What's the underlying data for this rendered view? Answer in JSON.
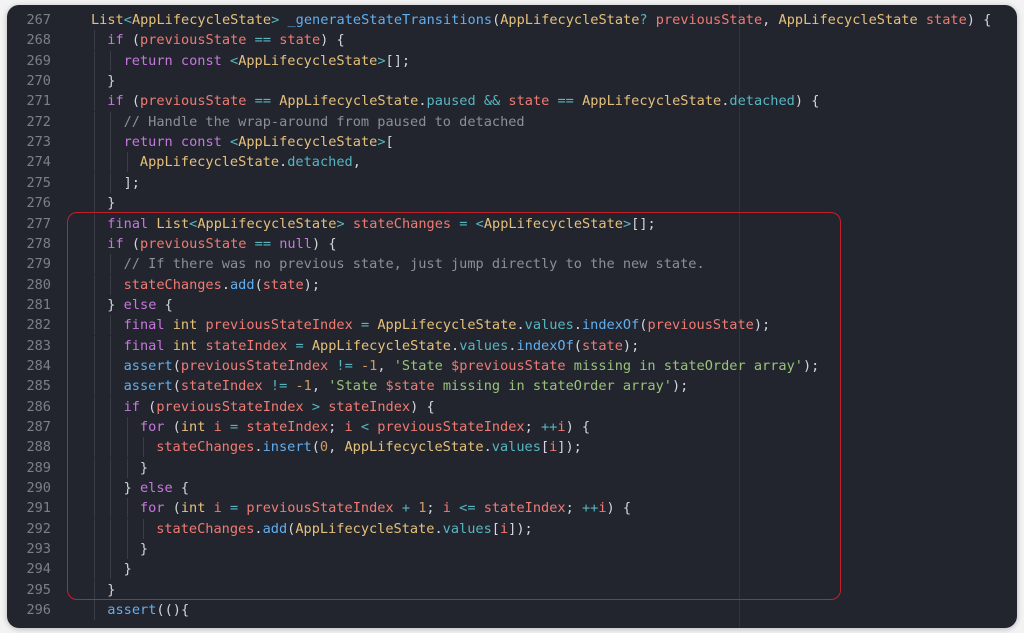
{
  "editor": {
    "lines": [
      {
        "n": "267",
        "indent": 0,
        "tokens": [
          [
            "ty",
            "List"
          ],
          [
            "op",
            "<"
          ],
          [
            "ty",
            "AppLifecycleState"
          ],
          [
            "op",
            "> "
          ],
          [
            "fn",
            "_generateStateTransitions"
          ],
          [
            "",
            "("
          ],
          [
            "ty",
            "AppLifecycleState"
          ],
          [
            "op",
            "? "
          ],
          [
            "pr",
            "previousState"
          ],
          [
            "",
            ", "
          ],
          [
            "ty",
            "AppLifecycleState"
          ],
          [
            "",
            " "
          ],
          [
            "pr",
            "state"
          ],
          [
            "",
            ") {"
          ]
        ]
      },
      {
        "n": "268",
        "indent": 1,
        "tokens": [
          [
            "kw",
            "if"
          ],
          [
            "",
            " ("
          ],
          [
            "pr",
            "previousState"
          ],
          [
            "op",
            " == "
          ],
          [
            "pr",
            "state"
          ],
          [
            "",
            ") {"
          ]
        ]
      },
      {
        "n": "269",
        "indent": 2,
        "tokens": [
          [
            "kw",
            "return"
          ],
          [
            "",
            " "
          ],
          [
            "kw",
            "const"
          ],
          [
            "",
            " "
          ],
          [
            "op",
            "<"
          ],
          [
            "ty",
            "AppLifecycleState"
          ],
          [
            "op",
            ">"
          ],
          [
            "",
            "[];"
          ]
        ]
      },
      {
        "n": "270",
        "indent": 1,
        "tokens": [
          [
            "",
            "}"
          ]
        ]
      },
      {
        "n": "271",
        "indent": 1,
        "tokens": [
          [
            "kw",
            "if"
          ],
          [
            "",
            " ("
          ],
          [
            "pr",
            "previousState"
          ],
          [
            "op",
            " == "
          ],
          [
            "ty",
            "AppLifecycleState"
          ],
          [
            "",
            "."
          ],
          [
            "op",
            "paused"
          ],
          [
            "op",
            " && "
          ],
          [
            "pr",
            "state"
          ],
          [
            "op",
            " == "
          ],
          [
            "ty",
            "AppLifecycleState"
          ],
          [
            "",
            "."
          ],
          [
            "op",
            "detached"
          ],
          [
            "",
            ") {"
          ]
        ]
      },
      {
        "n": "272",
        "indent": 2,
        "tokens": [
          [
            "cm",
            "// Handle the wrap-around from paused to detached"
          ]
        ]
      },
      {
        "n": "273",
        "indent": 2,
        "tokens": [
          [
            "kw",
            "return"
          ],
          [
            "",
            " "
          ],
          [
            "kw",
            "const"
          ],
          [
            "",
            " "
          ],
          [
            "op",
            "<"
          ],
          [
            "ty",
            "AppLifecycleState"
          ],
          [
            "op",
            ">"
          ],
          [
            "",
            "["
          ]
        ]
      },
      {
        "n": "274",
        "indent": 3,
        "tokens": [
          [
            "ty",
            "AppLifecycleState"
          ],
          [
            "",
            "."
          ],
          [
            "op",
            "detached"
          ],
          [
            "",
            ","
          ]
        ]
      },
      {
        "n": "275",
        "indent": 2,
        "tokens": [
          [
            "",
            "];"
          ]
        ]
      },
      {
        "n": "276",
        "indent": 1,
        "tokens": [
          [
            "",
            "}"
          ]
        ]
      },
      {
        "n": "277",
        "indent": 1,
        "tokens": [
          [
            "kw",
            "final"
          ],
          [
            "",
            " "
          ],
          [
            "ty",
            "List"
          ],
          [
            "op",
            "<"
          ],
          [
            "ty",
            "AppLifecycleState"
          ],
          [
            "op",
            "> "
          ],
          [
            "pr",
            "stateChanges"
          ],
          [
            "op",
            " = "
          ],
          [
            "op",
            "<"
          ],
          [
            "ty",
            "AppLifecycleState"
          ],
          [
            "op",
            ">"
          ],
          [
            "",
            "[];"
          ]
        ]
      },
      {
        "n": "278",
        "indent": 1,
        "tokens": [
          [
            "kw",
            "if"
          ],
          [
            "",
            " ("
          ],
          [
            "pr",
            "previousState"
          ],
          [
            "op",
            " == "
          ],
          [
            "kw",
            "null"
          ],
          [
            "",
            ") {"
          ]
        ]
      },
      {
        "n": "279",
        "indent": 2,
        "tokens": [
          [
            "cm",
            "// If there was no previous state, just jump directly to the new state."
          ]
        ]
      },
      {
        "n": "280",
        "indent": 2,
        "tokens": [
          [
            "pr",
            "stateChanges"
          ],
          [
            "",
            "."
          ],
          [
            "fn",
            "add"
          ],
          [
            "",
            "("
          ],
          [
            "pr",
            "state"
          ],
          [
            "",
            ");"
          ]
        ]
      },
      {
        "n": "281",
        "indent": 1,
        "tokens": [
          [
            "",
            "} "
          ],
          [
            "kw",
            "else"
          ],
          [
            "",
            " {"
          ]
        ]
      },
      {
        "n": "282",
        "indent": 2,
        "tokens": [
          [
            "kw",
            "final"
          ],
          [
            "",
            " "
          ],
          [
            "ty",
            "int"
          ],
          [
            "",
            " "
          ],
          [
            "pr",
            "previousStateIndex"
          ],
          [
            "op",
            " = "
          ],
          [
            "ty",
            "AppLifecycleState"
          ],
          [
            "",
            "."
          ],
          [
            "op",
            "values"
          ],
          [
            "",
            "."
          ],
          [
            "fn",
            "indexOf"
          ],
          [
            "",
            "("
          ],
          [
            "pr",
            "previousState"
          ],
          [
            "",
            ");"
          ]
        ]
      },
      {
        "n": "283",
        "indent": 2,
        "tokens": [
          [
            "kw",
            "final"
          ],
          [
            "",
            " "
          ],
          [
            "ty",
            "int"
          ],
          [
            "",
            " "
          ],
          [
            "pr",
            "stateIndex"
          ],
          [
            "op",
            " = "
          ],
          [
            "ty",
            "AppLifecycleState"
          ],
          [
            "",
            "."
          ],
          [
            "op",
            "values"
          ],
          [
            "",
            "."
          ],
          [
            "fn",
            "indexOf"
          ],
          [
            "",
            "("
          ],
          [
            "pr",
            "state"
          ],
          [
            "",
            ");"
          ]
        ]
      },
      {
        "n": "284",
        "indent": 2,
        "tokens": [
          [
            "fn",
            "assert"
          ],
          [
            "",
            "("
          ],
          [
            "pr",
            "previousStateIndex"
          ],
          [
            "op",
            " != "
          ],
          [
            "nm",
            "-1"
          ],
          [
            "",
            ", "
          ],
          [
            "st",
            "'State "
          ],
          [
            "pr",
            "$previousState"
          ],
          [
            "st",
            " missing in stateOrder array'"
          ],
          [
            "",
            ");"
          ]
        ]
      },
      {
        "n": "285",
        "indent": 2,
        "tokens": [
          [
            "fn",
            "assert"
          ],
          [
            "",
            "("
          ],
          [
            "pr",
            "stateIndex"
          ],
          [
            "op",
            " != "
          ],
          [
            "nm",
            "-1"
          ],
          [
            "",
            ", "
          ],
          [
            "st",
            "'State "
          ],
          [
            "pr",
            "$state"
          ],
          [
            "st",
            " missing in stateOrder array'"
          ],
          [
            "",
            ");"
          ]
        ]
      },
      {
        "n": "286",
        "indent": 2,
        "tokens": [
          [
            "kw",
            "if"
          ],
          [
            "",
            " ("
          ],
          [
            "pr",
            "previousStateIndex"
          ],
          [
            "op",
            " > "
          ],
          [
            "pr",
            "stateIndex"
          ],
          [
            "",
            ") {"
          ]
        ]
      },
      {
        "n": "287",
        "indent": 3,
        "tokens": [
          [
            "kw",
            "for"
          ],
          [
            "",
            " ("
          ],
          [
            "ty",
            "int"
          ],
          [
            "",
            " "
          ],
          [
            "pr",
            "i"
          ],
          [
            "op",
            " = "
          ],
          [
            "pr",
            "stateIndex"
          ],
          [
            "",
            "; "
          ],
          [
            "pr",
            "i"
          ],
          [
            "op",
            " < "
          ],
          [
            "pr",
            "previousStateIndex"
          ],
          [
            "",
            "; "
          ],
          [
            "op",
            "++"
          ],
          [
            "pr",
            "i"
          ],
          [
            "",
            ") {"
          ]
        ]
      },
      {
        "n": "288",
        "indent": 4,
        "tokens": [
          [
            "pr",
            "stateChanges"
          ],
          [
            "",
            "."
          ],
          [
            "fn",
            "insert"
          ],
          [
            "",
            "("
          ],
          [
            "nm",
            "0"
          ],
          [
            "",
            ", "
          ],
          [
            "ty",
            "AppLifecycleState"
          ],
          [
            "",
            "."
          ],
          [
            "op",
            "values"
          ],
          [
            "",
            "["
          ],
          [
            "pr",
            "i"
          ],
          [
            "",
            "]);"
          ]
        ]
      },
      {
        "n": "289",
        "indent": 3,
        "tokens": [
          [
            "",
            "}"
          ]
        ]
      },
      {
        "n": "290",
        "indent": 2,
        "tokens": [
          [
            "",
            "} "
          ],
          [
            "kw",
            "else"
          ],
          [
            "",
            " {"
          ]
        ]
      },
      {
        "n": "291",
        "indent": 3,
        "tokens": [
          [
            "kw",
            "for"
          ],
          [
            "",
            " ("
          ],
          [
            "ty",
            "int"
          ],
          [
            "",
            " "
          ],
          [
            "pr",
            "i"
          ],
          [
            "op",
            " = "
          ],
          [
            "pr",
            "previousStateIndex"
          ],
          [
            "op",
            " + "
          ],
          [
            "nm",
            "1"
          ],
          [
            "",
            "; "
          ],
          [
            "pr",
            "i"
          ],
          [
            "op",
            " <= "
          ],
          [
            "pr",
            "stateIndex"
          ],
          [
            "",
            "; "
          ],
          [
            "op",
            "++"
          ],
          [
            "pr",
            "i"
          ],
          [
            "",
            ") {"
          ]
        ]
      },
      {
        "n": "292",
        "indent": 4,
        "tokens": [
          [
            "pr",
            "stateChanges"
          ],
          [
            "",
            "."
          ],
          [
            "fn",
            "add"
          ],
          [
            "",
            "("
          ],
          [
            "ty",
            "AppLifecycleState"
          ],
          [
            "",
            "."
          ],
          [
            "op",
            "values"
          ],
          [
            "",
            "["
          ],
          [
            "pr",
            "i"
          ],
          [
            "",
            "]);"
          ]
        ]
      },
      {
        "n": "293",
        "indent": 3,
        "tokens": [
          [
            "",
            "}"
          ]
        ]
      },
      {
        "n": "294",
        "indent": 2,
        "tokens": [
          [
            "",
            "}"
          ]
        ]
      },
      {
        "n": "295",
        "indent": 1,
        "tokens": [
          [
            "",
            "}"
          ]
        ]
      },
      {
        "n": "296",
        "indent": 1,
        "tokens": [
          [
            "fn",
            "assert"
          ],
          [
            "",
            "(()"
          ],
          [
            "",
            "{"
          ]
        ]
      }
    ]
  },
  "colors": {
    "background": "#23252e",
    "highlight_border": "#c4202a"
  }
}
